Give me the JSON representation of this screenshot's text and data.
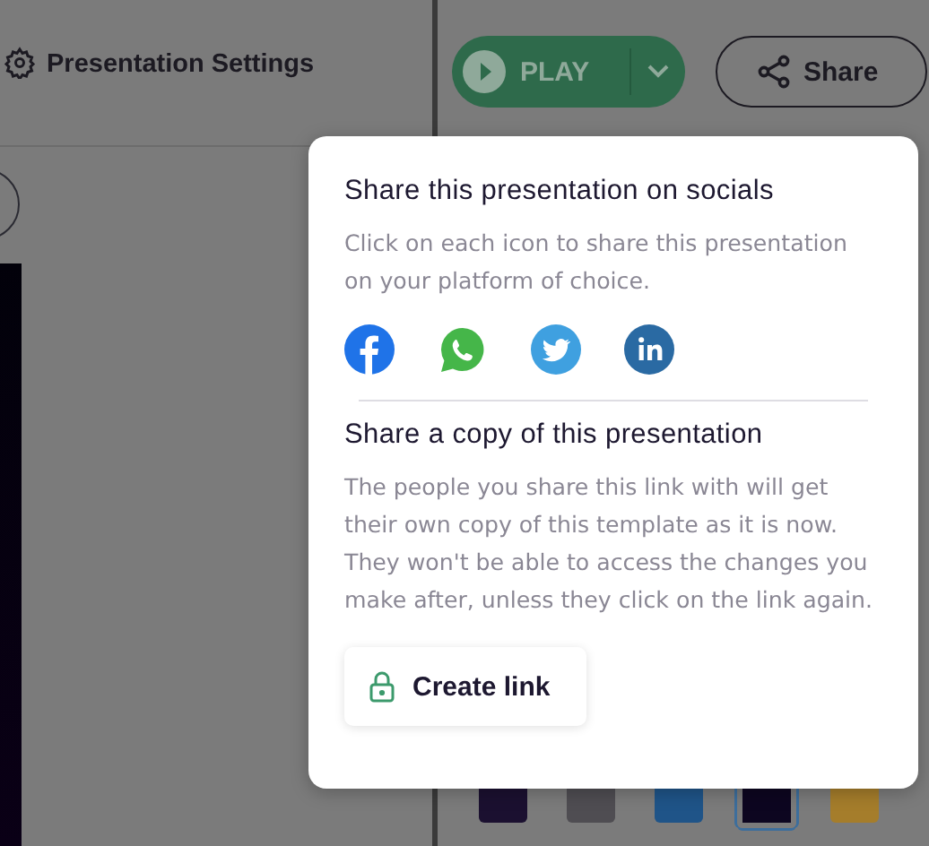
{
  "toolbar": {
    "settings_label": "Presentation Settings",
    "play_label": "PLAY",
    "share_label": "Share"
  },
  "share_popover": {
    "socials_title": "Share this presentation on socials",
    "socials_text": "Click on each icon to share this presentation on your platform of choice.",
    "social_icons": [
      {
        "kind": "facebook"
      },
      {
        "kind": "whatsapp"
      },
      {
        "kind": "twitter"
      },
      {
        "kind": "linkedin"
      }
    ],
    "copy_title": "Share a copy of this presentation",
    "copy_text": "The people you share this link with will get their own copy of this template as it is now. They won't be able to access the changes you make after, unless they click on the link again.",
    "create_link_label": "Create link"
  },
  "swatches": [
    {
      "color": "#1b1030",
      "selected": false
    },
    {
      "color": "#4f4d52",
      "selected": false
    },
    {
      "color": "#1f5488",
      "selected": false
    },
    {
      "color": "#0d0620",
      "selected": true
    },
    {
      "color": "#a57d2b",
      "selected": false
    }
  ]
}
